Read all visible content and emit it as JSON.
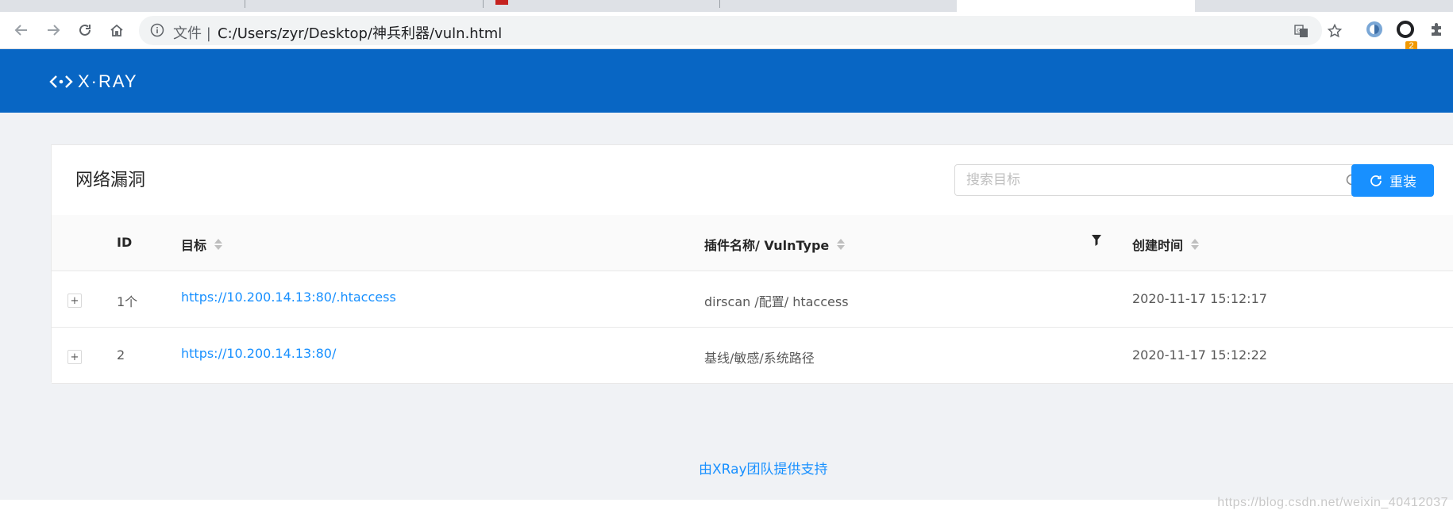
{
  "browser": {
    "url_prefix": "文件 |",
    "url": "C:/Users/zyr/Desktop/神兵利器/vuln.html",
    "extension_badge": "2"
  },
  "header": {
    "logo_text": "X·RAY"
  },
  "card": {
    "title": "网络漏洞",
    "search_placeholder": "搜索目标",
    "reload_label": "重装"
  },
  "table": {
    "columns": {
      "id": "ID",
      "target": "目标",
      "plugin": "插件名称/ VulnType",
      "created": "创建时间"
    },
    "rows": [
      {
        "expand": "+",
        "id": "1个",
        "target": "https://10.200.14.13:80/.htaccess",
        "plugin": "dirscan /配置/ htaccess",
        "created": "2020-11-17 15:12:17"
      },
      {
        "expand": "+",
        "id": "2",
        "target": "https://10.200.14.13:80/",
        "plugin": "基线/敏感/系统路径",
        "created": "2020-11-17 15:12:22"
      }
    ]
  },
  "footer": {
    "text": "由XRay团队提供支持"
  },
  "watermark": "https://blog.csdn.net/weixin_40412037",
  "colors": {
    "header_bg": "#0866c4",
    "primary": "#1890ff",
    "page_bg": "#f0f2f5"
  }
}
